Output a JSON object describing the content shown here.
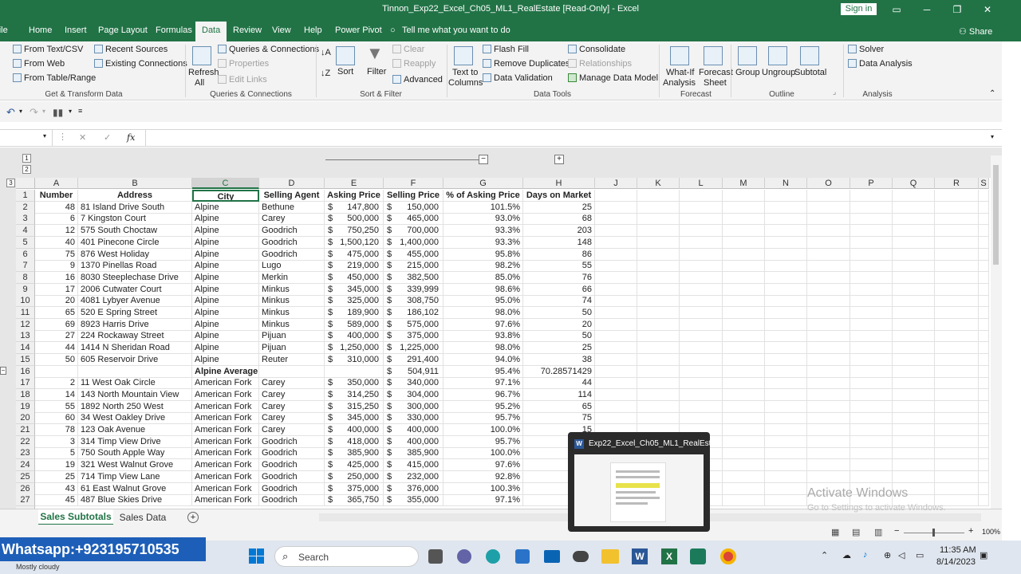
{
  "window": {
    "title": "Tinnon_Exp22_Excel_Ch05_ML1_RealEstate  [Read-Only]  -  Excel",
    "signin": "Sign in"
  },
  "tabs": [
    "File",
    "Home",
    "Insert",
    "Page Layout",
    "Formulas",
    "Data",
    "Review",
    "View",
    "Help",
    "Power Pivot"
  ],
  "tell": "Tell me what you want to do",
  "share": "Share",
  "ribbon": {
    "get": {
      "from_text": "From Text/CSV",
      "from_web": "From Web",
      "from_table": "From Table/Range",
      "recent": "Recent Sources",
      "existing": "Existing Connections",
      "label": "Get & Transform Data"
    },
    "queries": {
      "refresh": "Refresh",
      "refresh2": "All",
      "qc": "Queries & Connections",
      "props": "Properties",
      "links": "Edit Links",
      "label": "Queries & Connections"
    },
    "sort": {
      "sort": "Sort",
      "filter": "Filter",
      "clear": "Clear",
      "reapply": "Reapply",
      "advanced": "Advanced",
      "label": "Sort & Filter"
    },
    "tools": {
      "t2c": "Text to",
      "t2c2": "Columns",
      "flash": "Flash Fill",
      "remove": "Remove Duplicates",
      "valid": "Data Validation",
      "consol": "Consolidate",
      "rel": "Relationships",
      "model": "Manage Data Model",
      "label": "Data Tools"
    },
    "forecast": {
      "whatif": "What-If",
      "whatif2": "Analysis",
      "sheet": "Forecast",
      "sheet2": "Sheet",
      "label": "Forecast"
    },
    "outline": {
      "group": "Group",
      "ungroup": "Ungroup",
      "subtotal": "Subtotal",
      "label": "Outline"
    },
    "analysis": {
      "solver": "Solver",
      "da": "Data Analysis",
      "label": "Analysis"
    }
  },
  "formula": {
    "fx": "fx",
    "value": ""
  },
  "outline_levels": [
    "1",
    "2",
    "3"
  ],
  "columns": [
    "A",
    "B",
    "C",
    "D",
    "E",
    "F",
    "G",
    "H",
    "J",
    "K",
    "L",
    "M",
    "N",
    "O",
    "P",
    "Q",
    "R",
    "S"
  ],
  "header_row": {
    "num": "1",
    "cells": [
      "Number",
      "Address",
      "City",
      "Selling Agent",
      "Asking Price",
      "Selling Price",
      "% of Asking Price",
      "Days on Market"
    ]
  },
  "rows": [
    {
      "r": "2",
      "n": "48",
      "addr": "81 Island Drive South",
      "city": "Alpine",
      "agent": "Bethune",
      "ask": "147,800",
      "sell": "150,000",
      "pct": "101.5%",
      "days": "25"
    },
    {
      "r": "3",
      "n": "6",
      "addr": "7 Kingston Court",
      "city": "Alpine",
      "agent": "Carey",
      "ask": "500,000",
      "sell": "465,000",
      "pct": "93.0%",
      "days": "68"
    },
    {
      "r": "4",
      "n": "12",
      "addr": "575 South Choctaw",
      "city": "Alpine",
      "agent": "Goodrich",
      "ask": "750,250",
      "sell": "700,000",
      "pct": "93.3%",
      "days": "203"
    },
    {
      "r": "5",
      "n": "40",
      "addr": "401 Pinecone Circle",
      "city": "Alpine",
      "agent": "Goodrich",
      "ask": "1,500,120",
      "sell": "1,400,000",
      "pct": "93.3%",
      "days": "148"
    },
    {
      "r": "6",
      "n": "75",
      "addr": "876 West Holiday",
      "city": "Alpine",
      "agent": "Goodrich",
      "ask": "475,000",
      "sell": "455,000",
      "pct": "95.8%",
      "days": "86"
    },
    {
      "r": "7",
      "n": "9",
      "addr": "1370 Pinellas Road",
      "city": "Alpine",
      "agent": "Lugo",
      "ask": "219,000",
      "sell": "215,000",
      "pct": "98.2%",
      "days": "55"
    },
    {
      "r": "8",
      "n": "16",
      "addr": "8030 Steeplechase Drive",
      "city": "Alpine",
      "agent": "Merkin",
      "ask": "450,000",
      "sell": "382,500",
      "pct": "85.0%",
      "days": "76"
    },
    {
      "r": "9",
      "n": "17",
      "addr": "2006 Cutwater Court",
      "city": "Alpine",
      "agent": "Minkus",
      "ask": "345,000",
      "sell": "339,999",
      "pct": "98.6%",
      "days": "66"
    },
    {
      "r": "10",
      "n": "20",
      "addr": "4081 Lybyer Avenue",
      "city": "Alpine",
      "agent": "Minkus",
      "ask": "325,000",
      "sell": "308,750",
      "pct": "95.0%",
      "days": "74"
    },
    {
      "r": "11",
      "n": "65",
      "addr": "520 E Spring Street",
      "city": "Alpine",
      "agent": "Minkus",
      "ask": "189,900",
      "sell": "186,102",
      "pct": "98.0%",
      "days": "50"
    },
    {
      "r": "12",
      "n": "69",
      "addr": "8923 Harris Drive",
      "city": "Alpine",
      "agent": "Minkus",
      "ask": "589,000",
      "sell": "575,000",
      "pct": "97.6%",
      "days": "20"
    },
    {
      "r": "13",
      "n": "27",
      "addr": "224 Rockaway Street",
      "city": "Alpine",
      "agent": "Pijuan",
      "ask": "400,000",
      "sell": "375,000",
      "pct": "93.8%",
      "days": "50"
    },
    {
      "r": "14",
      "n": "44",
      "addr": "1414 N Sheridan Road",
      "city": "Alpine",
      "agent": "Pijuan",
      "ask": "1,250,000",
      "sell": "1,225,000",
      "pct": "98.0%",
      "days": "25"
    },
    {
      "r": "15",
      "n": "50",
      "addr": "605 Reservoir Drive",
      "city": "Alpine",
      "agent": "Reuter",
      "ask": "310,000",
      "sell": "291,400",
      "pct": "94.0%",
      "days": "38"
    },
    {
      "r": "16",
      "n": "",
      "addr": "",
      "city": "Alpine Average",
      "agent": "",
      "ask": "",
      "sell": "504,911",
      "pct": "95.4%",
      "days": "70.28571429",
      "avg": true
    },
    {
      "r": "17",
      "n": "2",
      "addr": "11 West Oak Circle",
      "city": "American Fork",
      "agent": "Carey",
      "ask": "350,000",
      "sell": "340,000",
      "pct": "97.1%",
      "days": "44"
    },
    {
      "r": "18",
      "n": "14",
      "addr": "143 North Mountain View",
      "city": "American Fork",
      "agent": "Carey",
      "ask": "314,250",
      "sell": "304,000",
      "pct": "96.7%",
      "days": "114"
    },
    {
      "r": "19",
      "n": "55",
      "addr": "1892 North 250 West",
      "city": "American Fork",
      "agent": "Carey",
      "ask": "315,250",
      "sell": "300,000",
      "pct": "95.2%",
      "days": "65"
    },
    {
      "r": "20",
      "n": "60",
      "addr": "34 West Oakley Drive",
      "city": "American Fork",
      "agent": "Carey",
      "ask": "345,000",
      "sell": "330,000",
      "pct": "95.7%",
      "days": "75"
    },
    {
      "r": "21",
      "n": "78",
      "addr": "123 Oak Avenue",
      "city": "American Fork",
      "agent": "Carey",
      "ask": "400,000",
      "sell": "400,000",
      "pct": "100.0%",
      "days": "15"
    },
    {
      "r": "22",
      "n": "3",
      "addr": "314 Timp View Drive",
      "city": "American Fork",
      "agent": "Goodrich",
      "ask": "418,000",
      "sell": "400,000",
      "pct": "95.7%",
      "days": ""
    },
    {
      "r": "23",
      "n": "5",
      "addr": "750 South Apple Way",
      "city": "American Fork",
      "agent": "Goodrich",
      "ask": "385,900",
      "sell": "385,900",
      "pct": "100.0%",
      "days": ""
    },
    {
      "r": "24",
      "n": "19",
      "addr": "321 West Walnut Grove",
      "city": "American Fork",
      "agent": "Goodrich",
      "ask": "425,000",
      "sell": "415,000",
      "pct": "97.6%",
      "days": ""
    },
    {
      "r": "25",
      "n": "25",
      "addr": "714 Timp View Lane",
      "city": "American Fork",
      "agent": "Goodrich",
      "ask": "250,000",
      "sell": "232,000",
      "pct": "92.8%",
      "days": ""
    },
    {
      "r": "26",
      "n": "43",
      "addr": "61 East Walnut Grove",
      "city": "American Fork",
      "agent": "Goodrich",
      "ask": "375,000",
      "sell": "376,000",
      "pct": "100.3%",
      "days": ""
    },
    {
      "r": "27",
      "n": "45",
      "addr": "487 Blue Skies Drive",
      "city": "American Fork",
      "agent": "Goodrich",
      "ask": "365,750",
      "sell": "355,000",
      "pct": "97.1%",
      "days": ""
    }
  ],
  "currency": "$",
  "sheets": [
    "Sales Subtotals",
    "Sales Data"
  ],
  "zoom": "100%",
  "watermark": {
    "l1": "Activate Windows",
    "l2": "Go to Settings to activate Windows."
  },
  "thumb_title": "Exp22_Excel_Ch05_ML1_RealEst...",
  "taskbar": {
    "promo": "Whatsapp:+923195710535",
    "weather": "Mostly cloudy",
    "search": "Search",
    "time": "11:35 AM",
    "date": "8/14/2023"
  }
}
